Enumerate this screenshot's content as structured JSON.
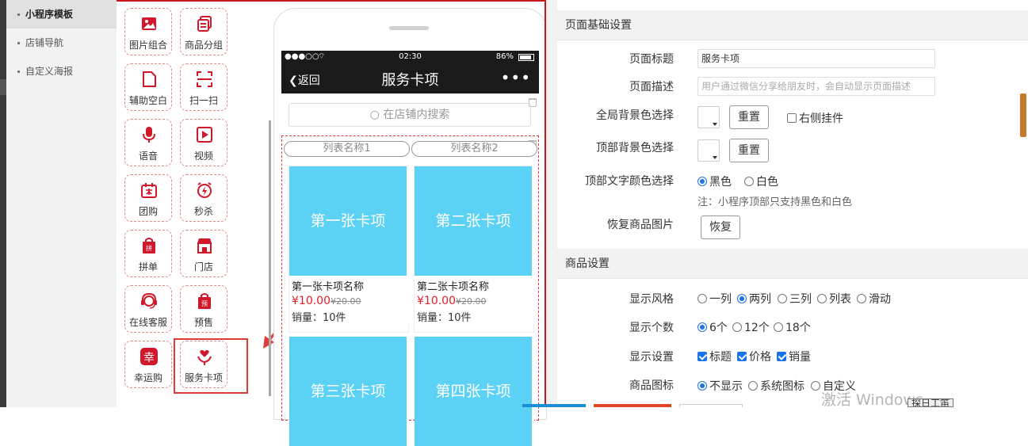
{
  "nav": {
    "items": [
      {
        "label": "小程序模板",
        "active": true
      },
      {
        "label": "店铺导航",
        "active": false
      },
      {
        "label": "自定义海报",
        "active": false
      }
    ]
  },
  "widgets": [
    {
      "label": "图片组合",
      "icon": "image-group-icon"
    },
    {
      "label": "商品分组",
      "icon": "product-group-icon"
    },
    {
      "label": "辅助空白",
      "icon": "blank-page-icon"
    },
    {
      "label": "扫一扫",
      "icon": "scan-icon"
    },
    {
      "label": "语音",
      "icon": "microphone-icon"
    },
    {
      "label": "视频",
      "icon": "video-icon"
    },
    {
      "label": "团购",
      "icon": "group-buy-icon"
    },
    {
      "label": "秒杀",
      "icon": "alarm-clock-icon"
    },
    {
      "label": "拼单",
      "icon": "shopping-bag-icon"
    },
    {
      "label": "门店",
      "icon": "store-icon"
    },
    {
      "label": "在线客服",
      "icon": "customer-service-icon"
    },
    {
      "label": "预售",
      "icon": "presale-icon"
    },
    {
      "label": "幸运购",
      "icon": "lucky-icon",
      "icon_text": "幸"
    },
    {
      "label": "服务卡项",
      "icon": "heart-hand-icon"
    }
  ],
  "phone": {
    "status": {
      "signal": "●●●○○",
      "time": "02:30",
      "battery": "86%"
    },
    "back_label": "返回",
    "title": "服务卡项",
    "more": "•••",
    "search_placeholder": "在店铺内搜索",
    "tabs": [
      "列表名称1",
      "列表名称2"
    ],
    "cards": [
      {
        "image_text": "第一张卡项",
        "name": "第一张卡项名称",
        "price": "¥10.00",
        "old_price": "¥20.00",
        "sales": "销量：10件"
      },
      {
        "image_text": "第二张卡项",
        "name": "第二张卡项名称",
        "price": "¥10.00",
        "old_price": "¥20.00",
        "sales": "销量：10件"
      },
      {
        "image_text": "第三张卡项"
      },
      {
        "image_text": "第四张卡项"
      }
    ]
  },
  "settings": {
    "page_section": "页面基础设置",
    "title_label": "页面标题",
    "title_value": "服务卡项",
    "desc_label": "页面描述",
    "desc_placeholder": "用户通过微信分享给朋友时，会自动显示页面描述",
    "global_bg_label": "全局背景色选择",
    "reset_label": "重置",
    "right_widget_label": "右侧挂件",
    "top_bg_label": "顶部背景色选择",
    "top_text_label": "顶部文字颜色选择",
    "color_black": "黑色",
    "color_white": "白色",
    "top_note": "注：小程序顶部只支持黑色和白色",
    "restore_label": "恢复商品图片",
    "restore_button": "恢复",
    "product_section": "商品设置",
    "style_label": "显示风格",
    "style_options": [
      "一列",
      "两列",
      "三列",
      "列表",
      "滑动"
    ],
    "style_selected": "两列",
    "count_label": "显示个数",
    "count_options": [
      "6个",
      "12个",
      "18个"
    ],
    "count_selected": "6个",
    "display_label": "显示设置",
    "display_options": [
      "标题",
      "价格",
      "销量"
    ],
    "icon_label": "商品图标",
    "icon_options": [
      "不显示",
      "系统图标",
      "自定义"
    ],
    "icon_selected": "不显示"
  },
  "watermark": "激活 Windows",
  "taskbar_text": "探日工笛"
}
